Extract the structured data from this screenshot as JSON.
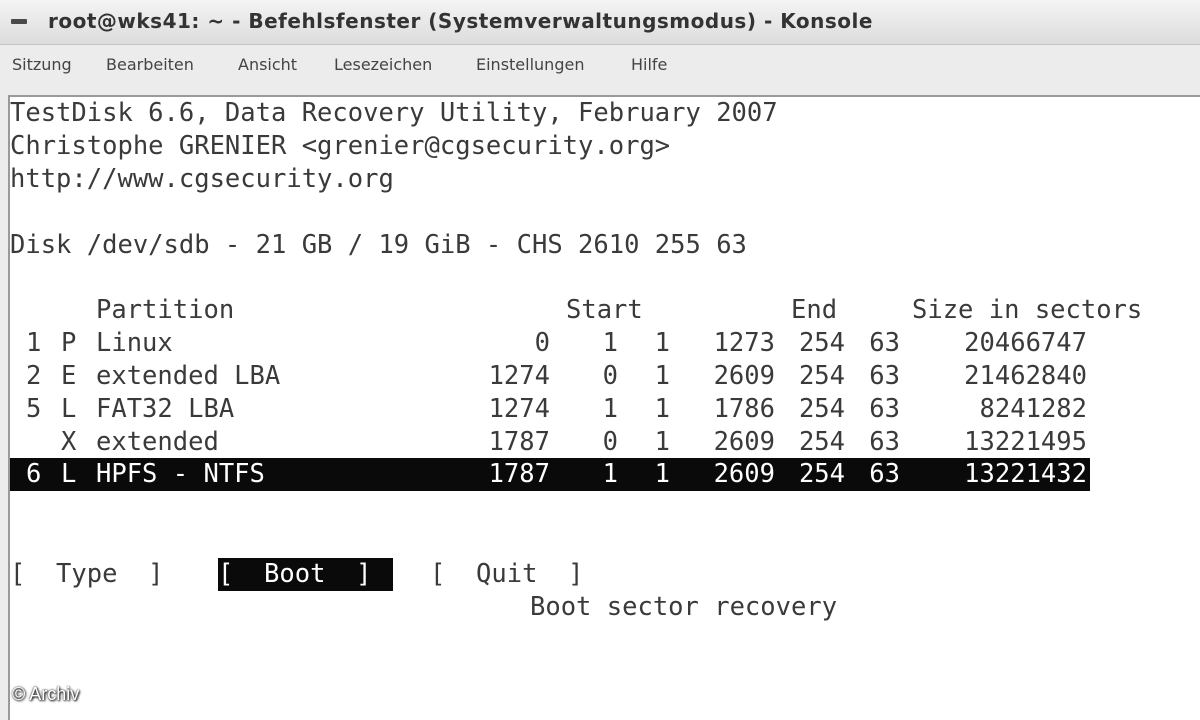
{
  "window": {
    "title": "root@wks41: ~ - Befehlsfenster (Systemverwaltungsmodus) - Konsole"
  },
  "menu": {
    "items": [
      "Sitzung",
      "Bearbeiten",
      "Ansicht",
      "Lesezeichen",
      "Einstellungen",
      "Hilfe"
    ]
  },
  "terminal": {
    "header": [
      "TestDisk 6.6, Data Recovery Utility, February 2007",
      "Christophe GRENIER <grenier@cgsecurity.org>",
      "http://www.cgsecurity.org"
    ],
    "disk_info": "Disk /dev/sdb - 21 GB / 19 GiB - CHS 2610 255 63",
    "table": {
      "headers": {
        "partition": "Partition",
        "start": "Start",
        "end": "End",
        "size": "Size in sectors"
      },
      "rows": [
        {
          "num": "1",
          "type": "P",
          "name": "Linux",
          "s_c": "0",
          "s_h": "1",
          "s_s": "1",
          "e_c": "1273",
          "e_h": "254",
          "e_s": "63",
          "size": "20466747"
        },
        {
          "num": "2",
          "type": "E",
          "name": "extended LBA",
          "s_c": "1274",
          "s_h": "0",
          "s_s": "1",
          "e_c": "2609",
          "e_h": "254",
          "e_s": "63",
          "size": "21462840"
        },
        {
          "num": "5",
          "type": "L",
          "name": "FAT32 LBA",
          "s_c": "1274",
          "s_h": "1",
          "s_s": "1",
          "e_c": "1786",
          "e_h": "254",
          "e_s": "63",
          "size": "8241282"
        },
        {
          "num": "",
          "type": "X",
          "name": "extended",
          "s_c": "1787",
          "s_h": "0",
          "s_s": "1",
          "e_c": "2609",
          "e_h": "254",
          "e_s": "63",
          "size": "13221495"
        },
        {
          "num": "6",
          "type": "L",
          "name": "HPFS - NTFS",
          "s_c": "1787",
          "s_h": "1",
          "s_s": "1",
          "e_c": "2609",
          "e_h": "254",
          "e_s": "63",
          "size": "13221432"
        }
      ],
      "selected_row": 4
    },
    "actions": {
      "type_label": "[  Type  ]",
      "boot_label": "[  Boot  ]",
      "quit_label": "[  Quit  ]",
      "selected": "boot"
    },
    "status_hint": "Boot sector recovery"
  },
  "watermark": "© Archiv"
}
